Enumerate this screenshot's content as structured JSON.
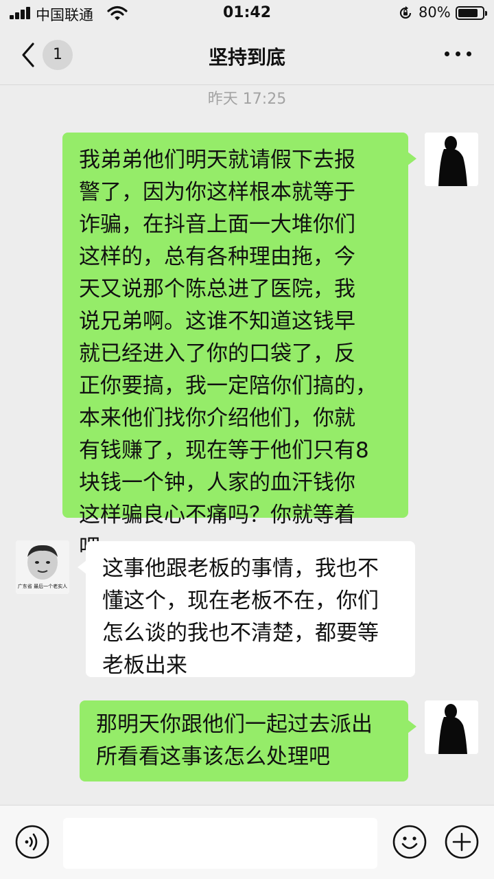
{
  "status_bar": {
    "carrier": "中国联通",
    "time": "01:42",
    "battery": "80%",
    "battery_level": 0.8
  },
  "nav": {
    "unread_count": "1",
    "title": "坚持到底"
  },
  "chat": {
    "timestamp": "昨天 17:25",
    "messages": [
      {
        "side": "right",
        "text": "我弟弟他们明天就请假下去报\n警了，因为你这样根本就等于\n诈骗，在抖音上面一大堆你们\n这样的，总有各种理由拖，今\n天又说那个陈总进了医院，我\n说兄弟啊。这谁不知道这钱早\n就已经进入了你的口袋了，反\n正你要搞，我一定陪你们搞的，\n本来他们找你介绍他们，你就\n有钱赚了，现在等于他们只有8\n块钱一个钟，人家的血汗钱你\n这样骗良心不痛吗？你就等着\n吧"
      },
      {
        "side": "left",
        "text": "这事他跟老板的事情，我也不\n懂这个，现在老板不在，你们\n怎么谈的我也不清楚，都要等\n老板出来",
        "avatar_label": "广东省 最后一个老实人"
      },
      {
        "side": "right",
        "text": "那明天你跟他们一起过去派出\n所看看这事该怎么处理吧"
      }
    ]
  },
  "colors": {
    "background": "#ededed",
    "sent_bubble": "#95ec69",
    "received_bubble": "#ffffff"
  },
  "icons": {
    "back": "chevron-left-icon",
    "more": "more-dots-icon",
    "voice": "voice-icon",
    "emoji": "emoji-icon",
    "plus": "plus-icon"
  }
}
